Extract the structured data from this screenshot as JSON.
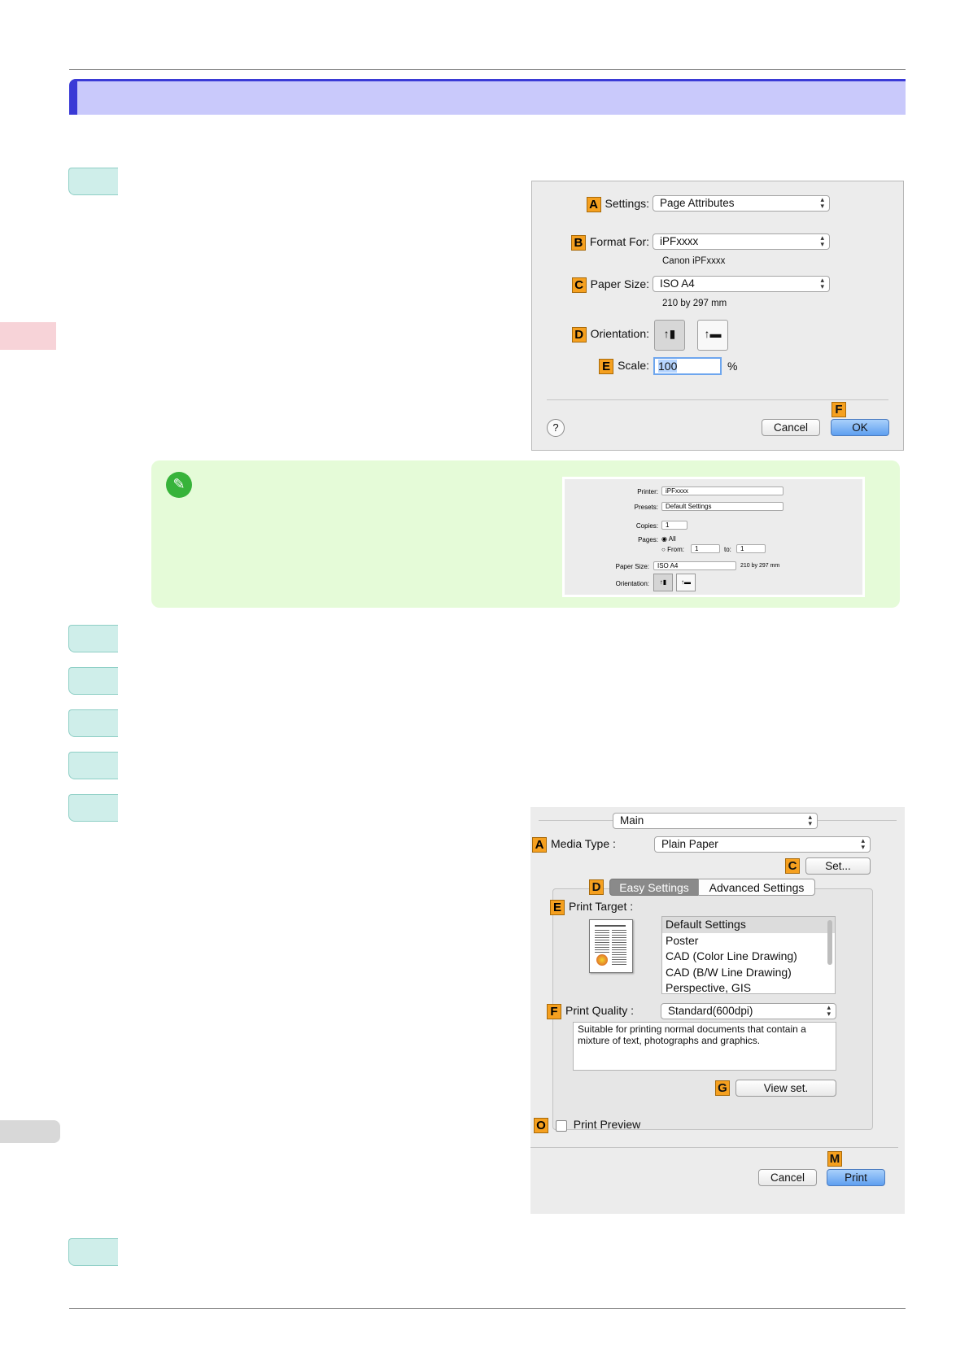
{
  "dialog1": {
    "settings_label": "Settings:",
    "settings_value": "Page Attributes",
    "format_label": "Format For:",
    "format_value": "iPFxxxx",
    "format_sub": "Canon iPFxxxx",
    "paper_label": "Paper Size:",
    "paper_value": "ISO A4",
    "paper_sub": "210 by 297 mm",
    "orientation_label": "Orientation:",
    "scale_label": "Scale:",
    "scale_value": "100",
    "scale_unit": "%",
    "help": "?",
    "cancel": "Cancel",
    "ok": "OK",
    "keys": {
      "a": "A",
      "b": "B",
      "c": "C",
      "d": "D",
      "e": "E",
      "f": "F"
    }
  },
  "note_dialog": {
    "printer_label": "Printer:",
    "printer_value": "iPFxxxx",
    "presets_label": "Presets:",
    "presets_value": "Default Settings",
    "copies_label": "Copies:",
    "copies_value": "1",
    "pages_label": "Pages:",
    "pages_all": "All",
    "pages_from": "From:",
    "from_value": "1",
    "pages_to": "to:",
    "to_value": "1",
    "paper_label": "Paper Size:",
    "paper_value": "ISO A4",
    "paper_sub": "210 by 297 mm",
    "orientation_label": "Orientation:"
  },
  "dialog2": {
    "panel_value": "Main",
    "media_label": "Media Type :",
    "media_value": "Plain Paper",
    "set_button": "Set...",
    "tab_easy": "Easy Settings",
    "tab_advanced": "Advanced Settings",
    "print_target_label": "Print Target :",
    "print_targets": [
      "Default Settings",
      "Poster",
      "CAD (Color Line Drawing)",
      "CAD (B/W Line Drawing)",
      "Perspective, GIS"
    ],
    "quality_label": "Print Quality :",
    "quality_value": "Standard(600dpi)",
    "description": "Suitable for printing normal documents that contain a mixture of text, photographs and graphics.",
    "view_set": "View set.",
    "print_preview": "Print Preview",
    "cancel": "Cancel",
    "print": "Print",
    "keys": {
      "a": "A",
      "c": "C",
      "d": "D",
      "e": "E",
      "f": "F",
      "g": "G",
      "o": "O",
      "m": "M"
    }
  }
}
